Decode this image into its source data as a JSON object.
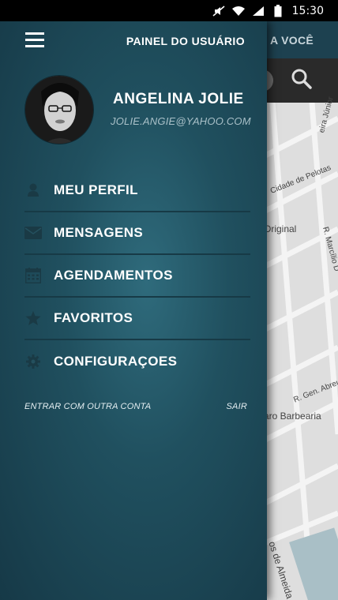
{
  "status_bar": {
    "time": "15:30"
  },
  "background": {
    "header_text": "S A VOCÊ",
    "map_labels": [
      "Cidade de Pelotas",
      "Original",
      "R. Marcílio D",
      "R. Gen. Abreu",
      "aro Barbearia",
      "os de Almeida",
      "eira Júnior"
    ]
  },
  "drawer": {
    "title": "PAINEL DO USUÁRIO",
    "user": {
      "name": "ANGELINA JOLIE",
      "email": "JOLIE.ANGIE@YAHOO.COM"
    },
    "menu": [
      {
        "label": "MEU PERFIL",
        "icon": "user-icon"
      },
      {
        "label": "MENSAGENS",
        "icon": "envelope-icon"
      },
      {
        "label": "AGENDAMENTOS",
        "icon": "calendar-icon"
      },
      {
        "label": "FAVORITOS",
        "icon": "star-icon"
      },
      {
        "label": "CONFIGURAÇOES",
        "icon": "gear-icon"
      }
    ],
    "footer": {
      "switch_account": "ENTRAR COM OUTRA CONTA",
      "logout": "SAIR"
    }
  },
  "colors": {
    "drawer_dark": "#163947",
    "drawer_light": "#2f6b7c",
    "header_bg": "#1d4150",
    "map_bg": "#dedede"
  }
}
